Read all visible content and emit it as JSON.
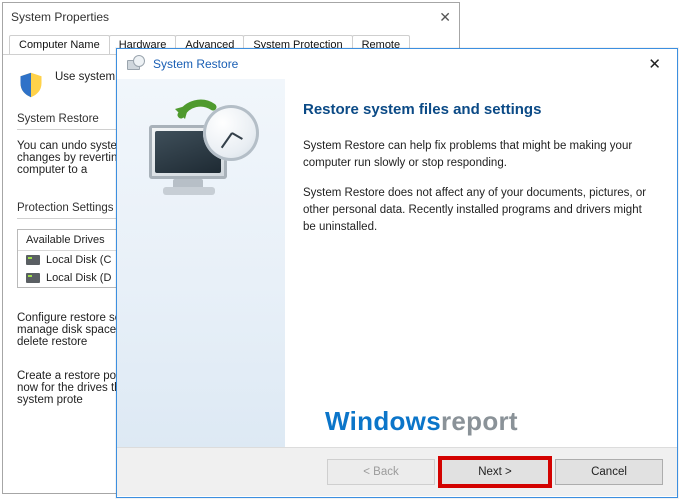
{
  "sysprops": {
    "title": "System Properties",
    "tabs": [
      "Computer Name",
      "Hardware",
      "Advanced",
      "System Protection",
      "Remote"
    ],
    "use_system_text": "Use system",
    "restore_section_label": "System Restore",
    "restore_desc": "You can undo system changes by reverting your computer to a",
    "protection_label": "Protection Settings",
    "available_drives_header": "Available Drives",
    "drives": [
      "Local Disk (C",
      "Local Disk (D"
    ],
    "configure_text": "Configure restore settings, manage disk space, and delete restore",
    "create_text": "Create a restore point right now for the drives that have system prote"
  },
  "restore": {
    "title": "System Restore",
    "heading": "Restore system files and settings",
    "para1": "System Restore can help fix problems that might be making your computer run slowly or stop responding.",
    "para2": "System Restore does not affect any of your documents, pictures, or other personal data. Recently installed programs and drivers might be uninstalled.",
    "buttons": {
      "back": "< Back",
      "next": "Next >",
      "cancel": "Cancel"
    },
    "watermark_a": "Windows",
    "watermark_b": "report"
  }
}
